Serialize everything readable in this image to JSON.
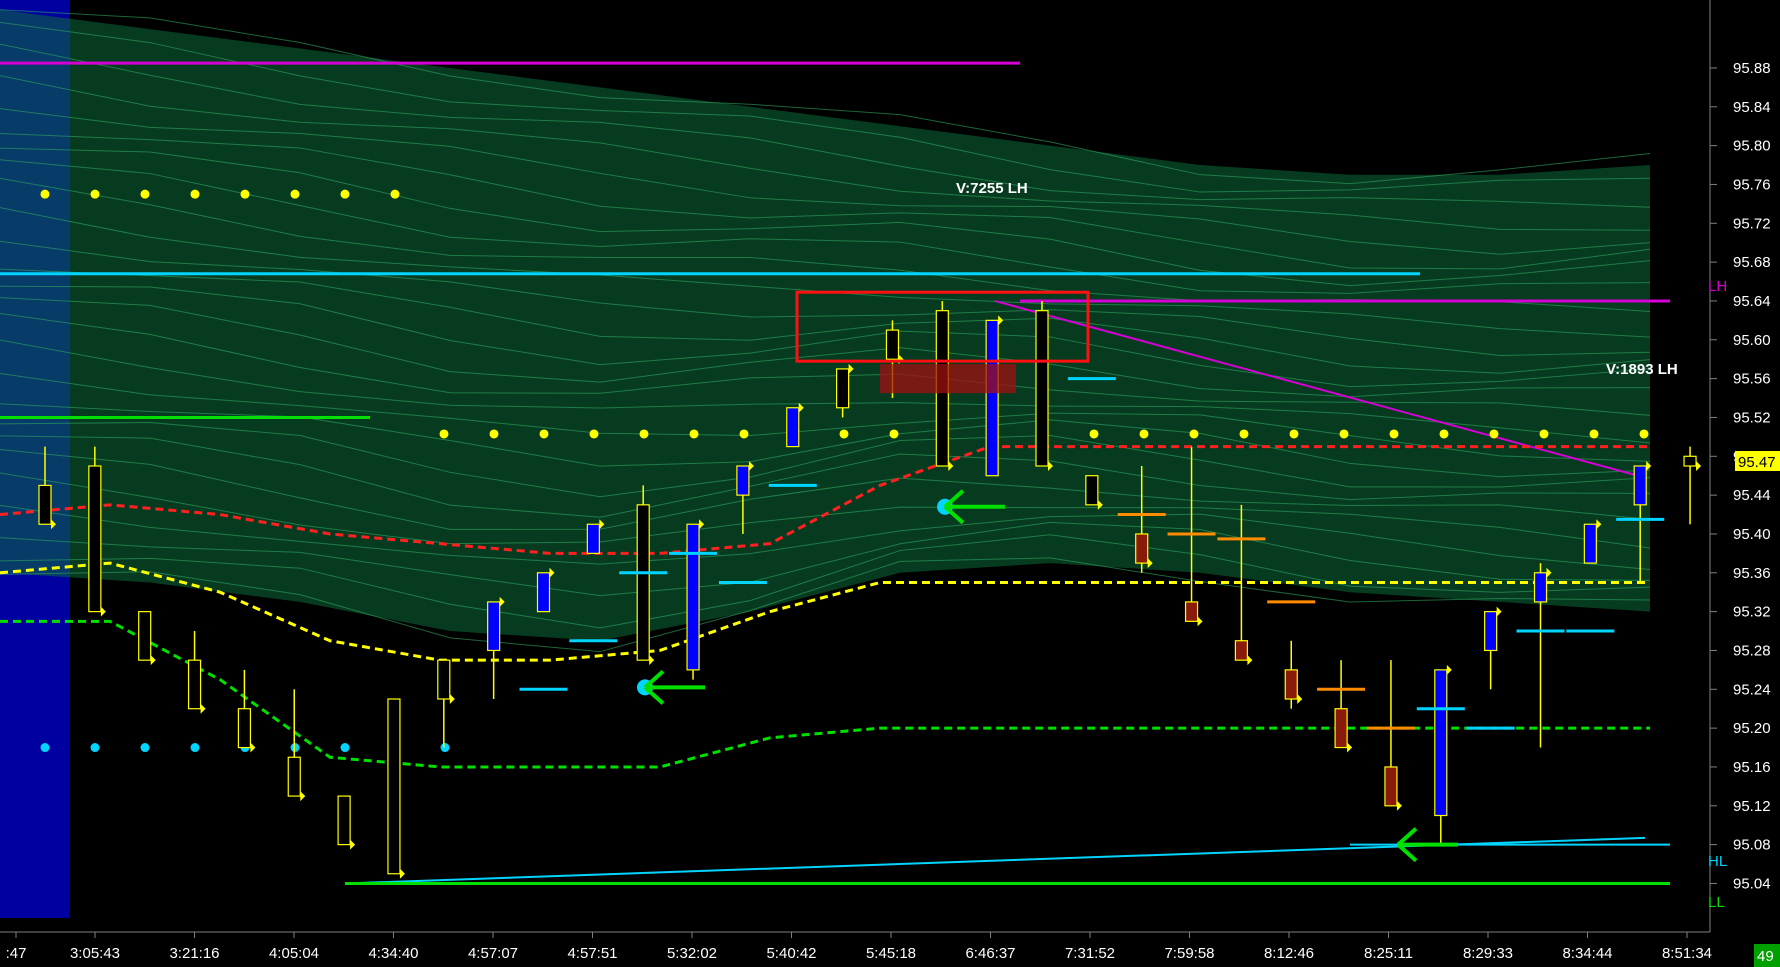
{
  "chart_data": {
    "type": "candlestick",
    "y_range": [
      94.99,
      95.95
    ],
    "y_tick_labels": [
      "95.88",
      "95.84",
      "95.80",
      "95.76",
      "95.72",
      "95.68",
      "95.64",
      "95.60",
      "95.56",
      "95.52",
      "95.48",
      "95.44",
      "95.40",
      "95.36",
      "95.32",
      "95.28",
      "95.24",
      "95.20",
      "95.16",
      "95.12",
      "95.08",
      "95.04"
    ],
    "y_ticks": [
      95.88,
      95.84,
      95.8,
      95.76,
      95.72,
      95.68,
      95.64,
      95.6,
      95.56,
      95.52,
      95.48,
      95.44,
      95.4,
      95.36,
      95.32,
      95.28,
      95.24,
      95.2,
      95.16,
      95.12,
      95.08,
      95.04
    ],
    "x_tick_labels": [
      ":47",
      "3:05:43",
      "3:21:16",
      "4:05:04",
      "4:34:40",
      "4:57:07",
      "4:57:51",
      "5:32:02",
      "5:40:42",
      "5:45:18",
      "6:46:37",
      "7:31:52",
      "7:59:58",
      "8:12:46",
      "8:25:11",
      "8:29:33",
      "8:34:44",
      "8:51:34"
    ],
    "candles": [
      {
        "o": 95.45,
        "h": 95.49,
        "l": 95.41,
        "c": 95.41,
        "color": "yellow"
      },
      {
        "o": 95.47,
        "h": 95.49,
        "l": 95.32,
        "c": 95.32,
        "color": "yellow"
      },
      {
        "o": 95.32,
        "h": 95.32,
        "l": 95.27,
        "c": 95.27,
        "color": "yellow"
      },
      {
        "o": 95.27,
        "h": 95.3,
        "l": 95.22,
        "c": 95.22,
        "color": "yellow"
      },
      {
        "o": 95.22,
        "h": 95.26,
        "l": 95.18,
        "c": 95.18,
        "color": "yellow"
      },
      {
        "o": 95.17,
        "h": 95.24,
        "l": 95.13,
        "c": 95.13,
        "color": "yellow"
      },
      {
        "o": 95.13,
        "h": 95.13,
        "l": 95.08,
        "c": 95.08,
        "color": "yellow"
      },
      {
        "o": 95.23,
        "h": 95.23,
        "l": 95.05,
        "c": 95.05,
        "color": "yellow"
      },
      {
        "o": 95.27,
        "h": 95.27,
        "l": 95.18,
        "c": 95.23,
        "color": "yellow"
      },
      {
        "o": 95.28,
        "h": 95.33,
        "l": 95.23,
        "c": 95.33,
        "color": "blue"
      },
      {
        "o": 95.32,
        "h": 95.36,
        "l": 95.32,
        "c": 95.36,
        "color": "blue"
      },
      {
        "o": 95.38,
        "h": 95.41,
        "l": 95.38,
        "c": 95.41,
        "color": "blue"
      },
      {
        "o": 95.43,
        "h": 95.45,
        "l": 95.27,
        "c": 95.27,
        "color": "yellow"
      },
      {
        "o": 95.26,
        "h": 95.41,
        "l": 95.25,
        "c": 95.41,
        "color": "blue"
      },
      {
        "o": 95.44,
        "h": 95.47,
        "l": 95.4,
        "c": 95.47,
        "color": "blue"
      },
      {
        "o": 95.49,
        "h": 95.53,
        "l": 95.49,
        "c": 95.53,
        "color": "blue"
      },
      {
        "o": 95.53,
        "h": 95.57,
        "l": 95.52,
        "c": 95.57,
        "color": "yellow"
      },
      {
        "o": 95.61,
        "h": 95.62,
        "l": 95.54,
        "c": 95.58,
        "color": "yellow"
      },
      {
        "o": 95.63,
        "h": 95.64,
        "l": 95.47,
        "c": 95.47,
        "color": "yellow"
      },
      {
        "o": 95.46,
        "h": 95.62,
        "l": 95.46,
        "c": 95.62,
        "color": "blue"
      },
      {
        "o": 95.63,
        "h": 95.64,
        "l": 95.47,
        "c": 95.47,
        "color": "yellow"
      },
      {
        "o": 95.46,
        "h": 95.46,
        "l": 95.43,
        "c": 95.43,
        "color": "yellow"
      },
      {
        "o": 95.4,
        "h": 95.47,
        "l": 95.36,
        "c": 95.37,
        "color": "red"
      },
      {
        "o": 95.33,
        "h": 95.49,
        "l": 95.33,
        "c": 95.31,
        "color": "red"
      },
      {
        "o": 95.29,
        "h": 95.43,
        "l": 95.27,
        "c": 95.27,
        "color": "red"
      },
      {
        "o": 95.26,
        "h": 95.29,
        "l": 95.22,
        "c": 95.23,
        "color": "red"
      },
      {
        "o": 95.22,
        "h": 95.27,
        "l": 95.18,
        "c": 95.18,
        "color": "red"
      },
      {
        "o": 95.16,
        "h": 95.27,
        "l": 95.12,
        "c": 95.12,
        "color": "red"
      },
      {
        "o": 95.11,
        "h": 95.26,
        "l": 95.08,
        "c": 95.26,
        "color": "blue"
      },
      {
        "o": 95.28,
        "h": 95.32,
        "l": 95.24,
        "c": 95.32,
        "color": "blue"
      },
      {
        "o": 95.33,
        "h": 95.37,
        "l": 95.18,
        "c": 95.36,
        "color": "blue"
      },
      {
        "o": 95.37,
        "h": 95.41,
        "l": 95.37,
        "c": 95.41,
        "color": "blue"
      },
      {
        "o": 95.43,
        "h": 95.47,
        "l": 95.35,
        "c": 95.47,
        "color": "blue"
      },
      {
        "o": 95.48,
        "h": 95.49,
        "l": 95.41,
        "c": 95.47,
        "color": "yellow"
      }
    ],
    "levels": {
      "LH": {
        "label": "LH",
        "value": 95.64,
        "color": "#d400d4"
      },
      "HL": {
        "label": "HL",
        "value": 95.08,
        "color": "#00d4ff"
      },
      "LL": {
        "label": "LL",
        "value": 95.04,
        "color": "#00e000"
      }
    },
    "current_price": {
      "label": "95.47",
      "value": 95.47
    },
    "annotations": [
      {
        "text": "V:7255 LH"
      },
      {
        "text": "V:1893 LH"
      }
    ],
    "corner_badge": "49"
  }
}
